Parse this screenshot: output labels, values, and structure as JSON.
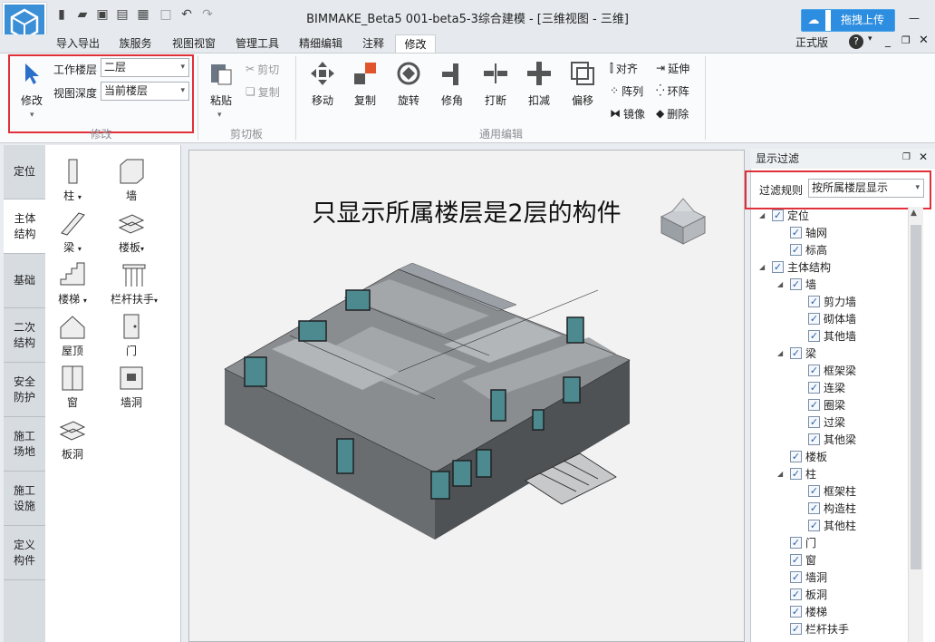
{
  "app": {
    "title": "BIMMAKE_Beta5 001-beta5-3综合建模 - [三维视图 - 三维]",
    "upload": "拖拽上传",
    "edition": "正式版",
    "help": "?"
  },
  "menu": [
    "导入导出",
    "族服务",
    "视图视窗",
    "管理工具",
    "精细编辑",
    "注释",
    "修改"
  ],
  "ribbon": {
    "modify": {
      "label": "修改",
      "work_floor_label": "工作楼层",
      "work_floor": "二层",
      "view_depth_label": "视图深度",
      "view_depth": "当前楼层",
      "group": "修改"
    },
    "clipboard": {
      "paste": "粘贴",
      "cut": "剪切",
      "copy": "复制",
      "group": "剪切板"
    },
    "general": {
      "items": [
        "移动",
        "复制",
        "旋转",
        "修角",
        "打断",
        "扣减",
        "偏移"
      ],
      "align": "对齐",
      "array": "阵列",
      "mirror": "镜像",
      "extend": "延伸",
      "ring": "环阵",
      "delete": "删除",
      "group": "通用编辑"
    }
  },
  "left_tabs": [
    "定位",
    "主体结构",
    "基础",
    "二次结构",
    "安全防护",
    "施工场地",
    "施工设施",
    "定义构件"
  ],
  "tools": [
    "柱",
    "墙",
    "梁",
    "楼板",
    "楼梯",
    "栏杆扶手",
    "屋顶",
    "门",
    "窗",
    "墙洞",
    "板洞"
  ],
  "viewport": {
    "caption": "只显示所属楼层是2层的构件"
  },
  "filter_panel": {
    "title": "显示过滤",
    "rule_label": "过滤规则",
    "rule": "按所属楼层显示"
  },
  "tree": [
    {
      "l": 0,
      "t": "定位",
      "e": true
    },
    {
      "l": 1,
      "t": "轴网"
    },
    {
      "l": 1,
      "t": "标高"
    },
    {
      "l": 0,
      "t": "主体结构",
      "e": true
    },
    {
      "l": 1,
      "t": "墙",
      "e": true
    },
    {
      "l": 2,
      "t": "剪力墙"
    },
    {
      "l": 2,
      "t": "砌体墙"
    },
    {
      "l": 2,
      "t": "其他墙"
    },
    {
      "l": 1,
      "t": "梁",
      "e": true
    },
    {
      "l": 2,
      "t": "框架梁"
    },
    {
      "l": 2,
      "t": "连梁"
    },
    {
      "l": 2,
      "t": "圈梁"
    },
    {
      "l": 2,
      "t": "过梁"
    },
    {
      "l": 2,
      "t": "其他梁"
    },
    {
      "l": 1,
      "t": "楼板"
    },
    {
      "l": 1,
      "t": "柱",
      "e": true
    },
    {
      "l": 2,
      "t": "框架柱"
    },
    {
      "l": 2,
      "t": "构造柱"
    },
    {
      "l": 2,
      "t": "其他柱"
    },
    {
      "l": 1,
      "t": "门"
    },
    {
      "l": 1,
      "t": "窗"
    },
    {
      "l": 1,
      "t": "墙洞"
    },
    {
      "l": 1,
      "t": "板洞"
    },
    {
      "l": 1,
      "t": "楼梯"
    },
    {
      "l": 1,
      "t": "栏杆扶手"
    }
  ],
  "colors": {
    "accent": "#2d8de0",
    "highlight": "#e0313a"
  }
}
